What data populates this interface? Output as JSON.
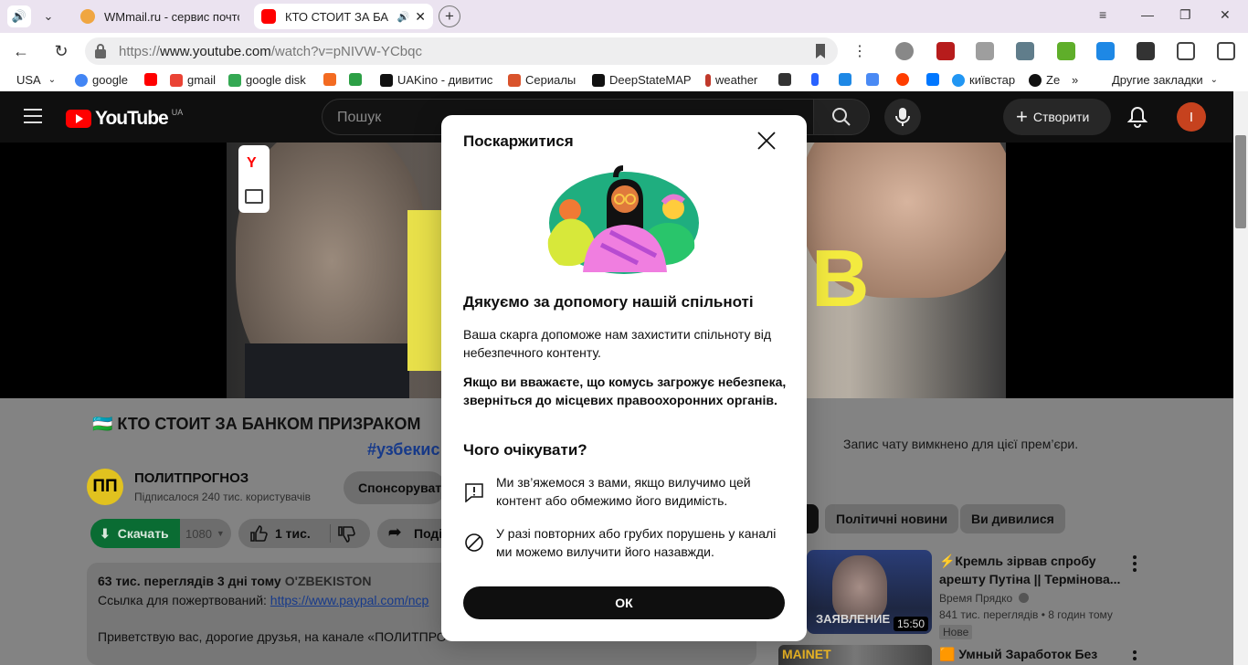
{
  "browser": {
    "tabs": [
      {
        "title": "WMmail.ru - сервис почто",
        "favicon_color": "#f0a641"
      },
      {
        "title": "КТО СТОИТ ЗА БА",
        "favicon_color": "#ff0000"
      }
    ],
    "url_prefix": "https://",
    "url_domain": "www.youtube.com",
    "url_path": "/watch?v=pNIVW-YCbqc",
    "bookmarks": [
      {
        "label": "USA",
        "color": "#ffffff"
      },
      {
        "label": "google",
        "color": "#4285f4"
      },
      {
        "label": "",
        "color": "#ff0000"
      },
      {
        "label": "gmail",
        "color": "#ea4335"
      },
      {
        "label": "google disk",
        "color": "#34a853"
      },
      {
        "label": "",
        "color": "#f36b21"
      },
      {
        "label": "",
        "color": "#2c9f45"
      },
      {
        "label": "UAKino - дивитис",
        "color": "#111111"
      },
      {
        "label": "Сериалы",
        "color": "#d9532c"
      },
      {
        "label": "DeepStateMAP",
        "color": "#111111"
      },
      {
        "label": "weather",
        "color": "#c0392b"
      },
      {
        "label": "",
        "color": "#333333"
      },
      {
        "label": "",
        "color": "#2962ff"
      },
      {
        "label": "",
        "color": "#1e88e5"
      },
      {
        "label": "",
        "color": "#4a8af4"
      },
      {
        "label": "",
        "color": "#ff3d00"
      },
      {
        "label": "",
        "color": "#0077ff"
      },
      {
        "label": "київстар",
        "color": "#2196f3"
      },
      {
        "label": "Ze",
        "color": "#111111"
      }
    ],
    "other_bookmarks": "Другие закладки",
    "more_chevron": "»"
  },
  "youtube": {
    "logo_text": "YouTube",
    "logo_region": "UA",
    "search_placeholder": "Пошук",
    "create_label": "Створити",
    "avatar_letter": "I",
    "video": {
      "title": "🇺🇿 КТО СТОИТ ЗА БАНКОМ ПРИЗРАКОМ",
      "hashtag": "#узбекис",
      "thumb_letter": "B"
    },
    "channel": {
      "logo_text": "ПП",
      "name": "ПОЛИТПРОГНОЗ",
      "subscribers": "Підписалося 240 тис. користувачів",
      "sponsor_label": "Спонсорувати"
    },
    "actions": {
      "download_label": "Скачать",
      "quality": "1080",
      "likes": "1 тис.",
      "share_label": "Поді"
    },
    "description": {
      "meta": "63 тис. переглядів  3 дні тому",
      "tag": "O'ZBEKISTON",
      "donate_prefix": "Ссылка для пожертвований: ",
      "donate_link": "https://www.paypal.com/ncp",
      "greeting": "Приветствую вас, дорогие друзья, на канале «ПОЛИТПРО"
    },
    "chat_off": "Запис чату вимкнено для цієї прем’єри.",
    "chips": [
      "Політичні новини",
      "Ви дивилися"
    ],
    "recommendations": [
      {
        "title": "⚡Кремль зірвав спробу арешту Путіна || Термінова...",
        "thumb_label": "ЗАЯВЛЕНИЕ",
        "duration": "15:50",
        "channel": "Время Прядко",
        "views": "841 тис. переглядів",
        "age": "8 годин тому",
        "badge": "Нове"
      },
      {
        "title": "🟧 Умный Заработок Без",
        "thumb_label": "MAINET"
      }
    ]
  },
  "report_dialog": {
    "title": "Поскаржитися",
    "heading": "Дякуємо за допомогу нашій спільноті",
    "body1": "Ваша скарга допоможе нам захистити спільноту від небезпечного контенту.",
    "body2": "Якщо ви вважаєте, що комусь загрожує небезпека, зверніться до місцевих правоохоронних органів.",
    "expect_heading": "Чого очікувати?",
    "expect_items": [
      {
        "icon": "report-flag-icon",
        "text": "Ми зв’яжемося з вами, якщо вилучимо цей контент або обмежимо його видимість."
      },
      {
        "icon": "ban-icon",
        "text": "У разі повторних або грубих порушень у каналі ми можемо вилучити його назавжди."
      }
    ],
    "ok_label": "ОК"
  }
}
